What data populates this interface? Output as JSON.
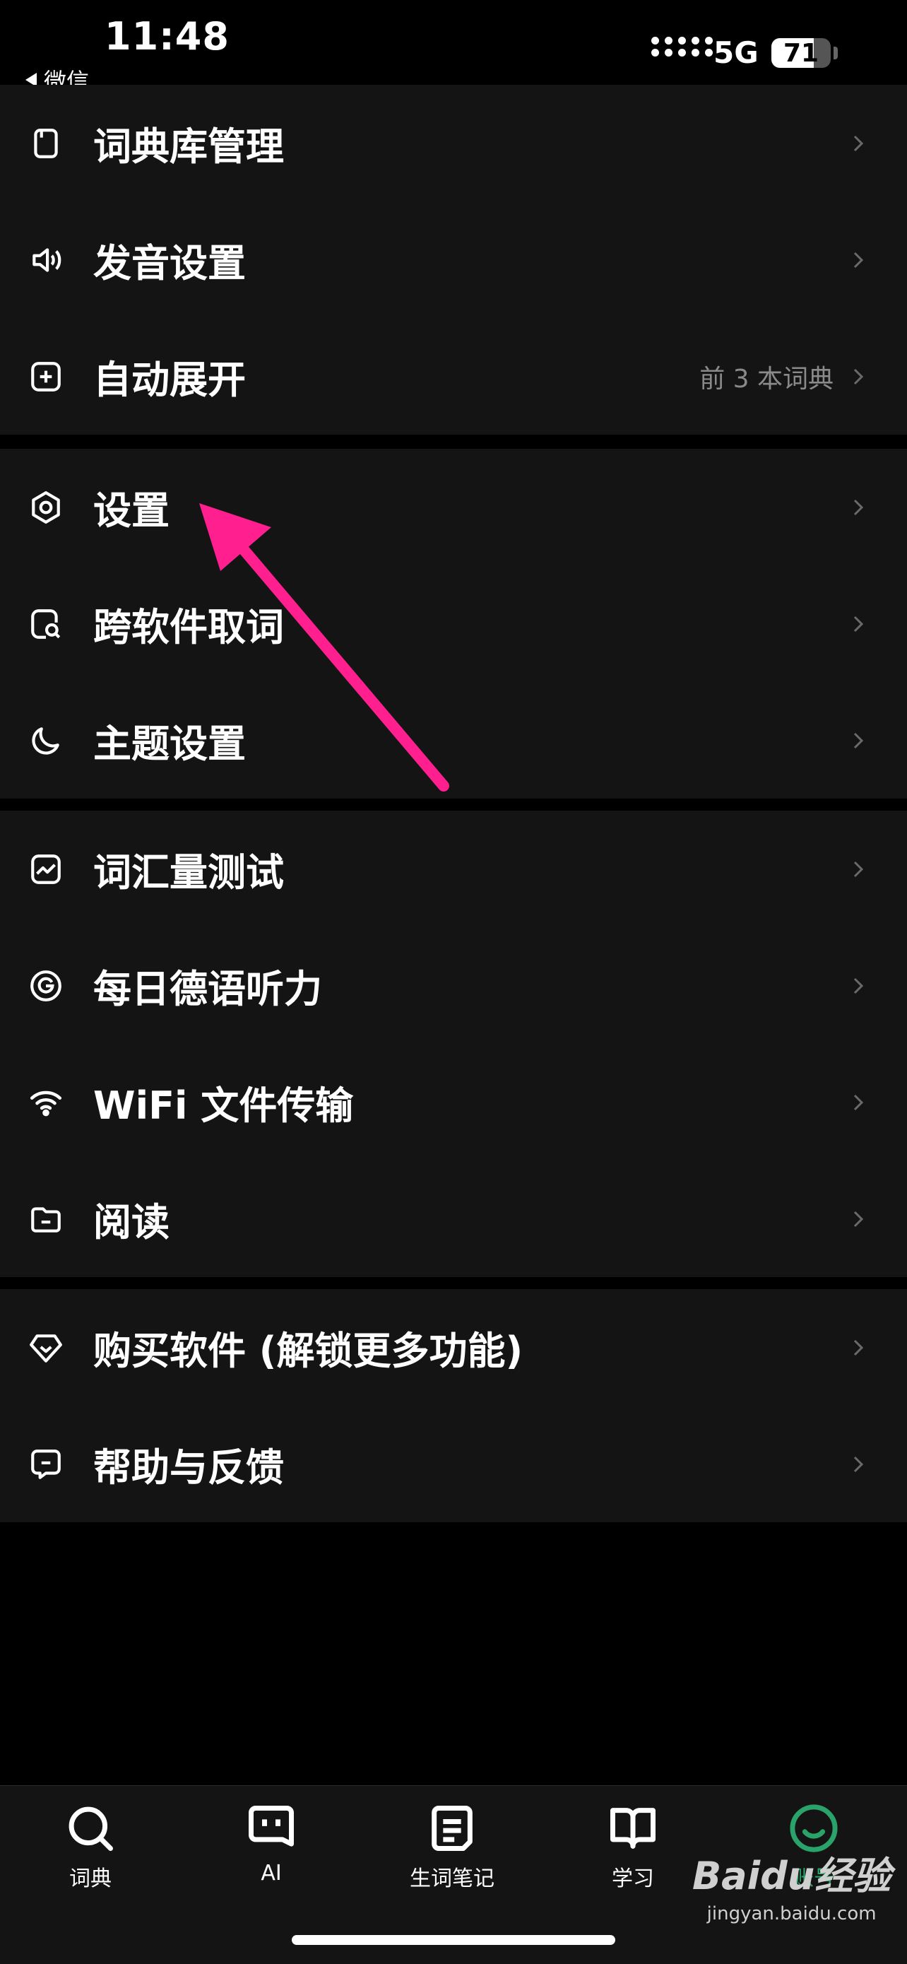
{
  "status_bar": {
    "time": "11:48",
    "back_app": "微信",
    "network": "5G",
    "battery": "71",
    "battery_level": 0.71
  },
  "menu_groups": [
    {
      "items": [
        {
          "icon": "book-icon",
          "label": "词典库管理",
          "value": ""
        },
        {
          "icon": "speaker-icon",
          "label": "发音设置",
          "value": ""
        },
        {
          "icon": "plus-square-icon",
          "label": "自动展开",
          "value": "前 3 本词典"
        }
      ]
    },
    {
      "items": [
        {
          "icon": "hexagon-settings-icon",
          "label": "设置",
          "value": ""
        },
        {
          "icon": "search-doc-icon",
          "label": "跨软件取词",
          "value": ""
        },
        {
          "icon": "moon-icon",
          "label": "主题设置",
          "value": ""
        }
      ]
    },
    {
      "items": [
        {
          "icon": "chart-icon",
          "label": "词汇量测试",
          "value": ""
        },
        {
          "icon": "target-icon",
          "label": "每日德语听力",
          "value": ""
        },
        {
          "icon": "wifi-icon",
          "label": "WiFi 文件传输",
          "value": ""
        },
        {
          "icon": "folder-icon",
          "label": "阅读",
          "value": ""
        }
      ]
    },
    {
      "items": [
        {
          "icon": "diamond-icon",
          "label": "购买软件 (解锁更多功能)",
          "value": ""
        },
        {
          "icon": "chat-icon",
          "label": "帮助与反馈",
          "value": ""
        }
      ]
    }
  ],
  "tab_bar": [
    {
      "icon": "search-icon",
      "label": "词典",
      "active": false
    },
    {
      "icon": "ai-icon",
      "label": "AI",
      "active": false
    },
    {
      "icon": "notes-icon",
      "label": "生词笔记",
      "active": false
    },
    {
      "icon": "book-open-icon",
      "label": "学习",
      "active": false
    },
    {
      "icon": "smile-icon",
      "label": "账号",
      "active": true
    }
  ],
  "watermark": {
    "logo": "Baidu经验",
    "url": "jingyan.baidu.com"
  },
  "colors": {
    "background": "#000000",
    "card": "#141414",
    "accent": "#29a36a",
    "annotation_arrow": "#ff1f8e"
  }
}
